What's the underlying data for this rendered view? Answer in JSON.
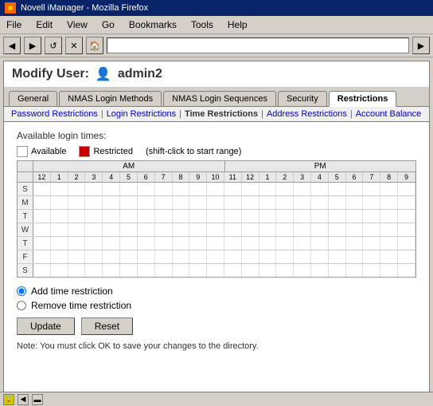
{
  "titleBar": {
    "icon": "N",
    "title": "Novell iManager - Mozilla Firefox"
  },
  "menuBar": {
    "items": [
      "File",
      "Edit",
      "View",
      "Go",
      "Bookmarks",
      "Tools",
      "Help"
    ]
  },
  "toolbar": {
    "addressBarValue": ""
  },
  "pageHeader": {
    "label": "Modify User:",
    "username": "admin2"
  },
  "tabs": {
    "items": [
      "General",
      "NMAS Login Methods",
      "NMAS Login Sequences",
      "Security",
      "Restrictions"
    ],
    "activeIndex": 4
  },
  "subTabs": {
    "items": [
      "Password Restrictions",
      "Login Restrictions",
      "Time Restrictions",
      "Address Restrictions",
      "Account Balance"
    ],
    "activeIndex": 2
  },
  "timeGrid": {
    "legend": {
      "availableLabel": "Available",
      "restrictedLabel": "Restricted",
      "hintLabel": "(shift-click to start range)"
    },
    "amLabel": "AM",
    "pmLabel": "PM",
    "hours": [
      "12",
      "1",
      "2",
      "3",
      "4",
      "5",
      "6",
      "7",
      "8",
      "9",
      "10",
      "11",
      "12",
      "1",
      "2",
      "3",
      "4",
      "5",
      "6",
      "7",
      "8",
      "9"
    ],
    "days": [
      {
        "label": "S"
      },
      {
        "label": "M"
      },
      {
        "label": "T"
      },
      {
        "label": "W"
      },
      {
        "label": "T"
      },
      {
        "label": "F"
      },
      {
        "label": "S"
      }
    ]
  },
  "radioGroup": {
    "options": [
      "Add time restriction",
      "Remove time restriction"
    ],
    "selectedIndex": 0
  },
  "buttons": {
    "update": "Update",
    "reset": "Reset"
  },
  "note": "Note: You must click OK to save your changes to the directory."
}
